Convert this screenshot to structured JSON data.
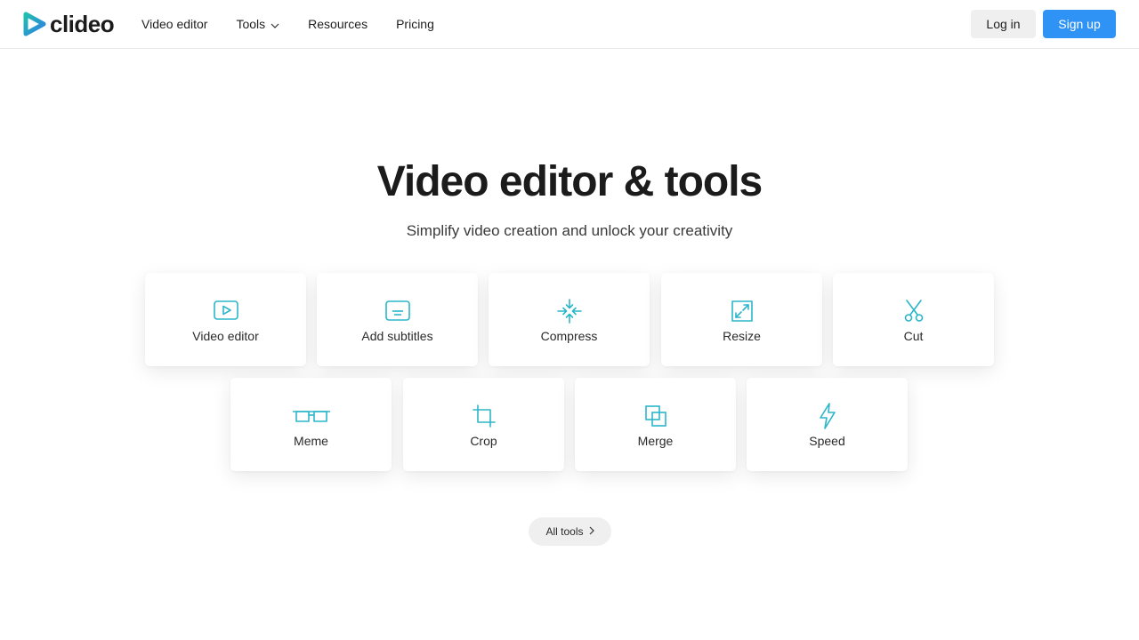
{
  "brand": {
    "name": "clideo",
    "accent": "#2bb5c9",
    "logo_colors": [
      "#1fbfae",
      "#2f7fe6"
    ]
  },
  "nav": {
    "items": [
      {
        "label": "Video editor"
      },
      {
        "label": "Tools",
        "has_dropdown": true
      },
      {
        "label": "Resources"
      },
      {
        "label": "Pricing"
      }
    ]
  },
  "auth": {
    "login_label": "Log in",
    "signup_label": "Sign up",
    "signup_color": "#2f93f5"
  },
  "hero": {
    "title": "Video editor & tools",
    "subtitle": "Simplify video creation and unlock your creativity"
  },
  "tools": [
    {
      "label": "Video editor",
      "icon": "play-screen-icon"
    },
    {
      "label": "Add subtitles",
      "icon": "subtitles-icon"
    },
    {
      "label": "Compress",
      "icon": "compress-icon"
    },
    {
      "label": "Resize",
      "icon": "resize-icon"
    },
    {
      "label": "Cut",
      "icon": "scissors-icon"
    },
    {
      "label": "Meme",
      "icon": "glasses-icon"
    },
    {
      "label": "Crop",
      "icon": "crop-icon"
    },
    {
      "label": "Merge",
      "icon": "merge-icon"
    },
    {
      "label": "Speed",
      "icon": "lightning-icon"
    }
  ],
  "all_tools": {
    "label": "All tools"
  }
}
